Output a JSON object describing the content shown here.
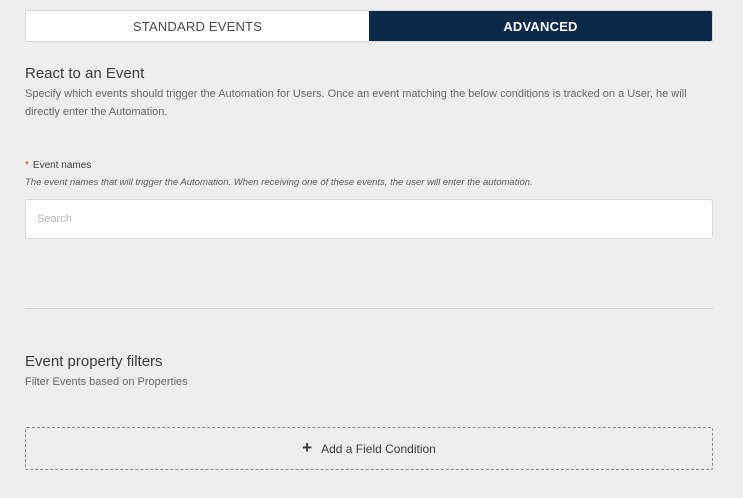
{
  "tabs": {
    "standard_label": "STANDARD EVENTS",
    "advanced_label": "ADVANCED",
    "active": "advanced"
  },
  "react_section": {
    "title": "React to an Event",
    "description": "Specify which events should trigger the Automation for Users. Once an event matching the below conditions is tracked on a User, he will directly enter the Automation."
  },
  "event_names_field": {
    "required_marker": "*",
    "label": "Event names",
    "help": "The event names that will trigger the Automation. When receiving one of these events, the user will enter the automation.",
    "value": "",
    "placeholder": "Search"
  },
  "filters_section": {
    "title": "Event property filters",
    "description": "Filter Events based on Properties"
  },
  "add_condition": {
    "icon": "plus-icon",
    "icon_glyph": "+",
    "label": "Add a Field Condition"
  },
  "colors": {
    "active_tab_bg": "#0a2947",
    "page_bg": "#eeeeee",
    "required": "#c0392b"
  }
}
